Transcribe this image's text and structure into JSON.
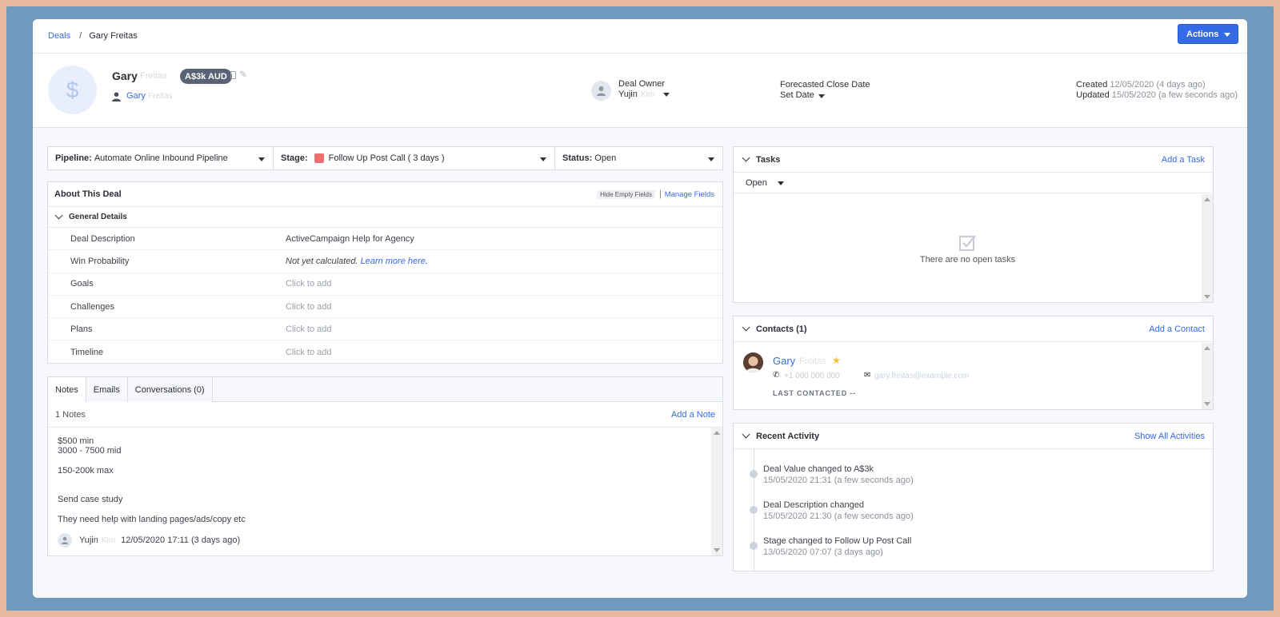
{
  "breadcrumb": {
    "parent": "Deals",
    "separator": "/",
    "current": "Gary Freitas"
  },
  "actions_label": "Actions",
  "header": {
    "avatar_glyph": "$",
    "deal_first_name": "Gary",
    "deal_last_name_obscured": "Freitas",
    "value_badge": "A$3k AUD",
    "contact_first_name": "Gary",
    "contact_last_name_obscured": "Freitas",
    "owner_label": "Deal Owner",
    "owner_name": "Yujin",
    "owner_name_obscured": "Kim",
    "close_label": "Forecasted Close Date",
    "close_value": "Set Date",
    "created_label": "Created",
    "created_value": "12/05/2020 (4 days ago)",
    "updated_label": "Updated",
    "updated_value": "15/05/2020 (a few seconds ago)"
  },
  "pipeline": {
    "pipeline_label": "Pipeline:",
    "pipeline_value": "Automate Online Inbound Pipeline",
    "stage_label": "Stage:",
    "stage_value": "Follow Up Post Call ( 3 days )",
    "stage_color": "#f06e72",
    "status_label": "Status:",
    "status_value": "Open"
  },
  "about": {
    "title": "About This Deal",
    "hide_empty": "Hide Empty Fields",
    "divider": "|",
    "manage_fields": "Manage Fields",
    "section": "General Details",
    "rows": [
      {
        "label": "Deal Description",
        "value": "ActiveCampaign Help for Agency"
      },
      {
        "label": "Win Probability",
        "value": "Not yet calculated.",
        "link": "Learn more here",
        "suffix": "."
      },
      {
        "label": "Goals",
        "value": "Click to add"
      },
      {
        "label": "Challenges",
        "value": "Click to add"
      },
      {
        "label": "Plans",
        "value": "Click to add"
      },
      {
        "label": "Timeline",
        "value": "Click to add"
      }
    ]
  },
  "notes": {
    "tabs": [
      "Notes",
      "Emails",
      "Conversations (0)"
    ],
    "count": "1 Notes",
    "add_label": "Add a Note",
    "body": [
      "$500 min",
      "3000 - 7500 mid",
      "150-200k max",
      "Send case study",
      "They need help with landing pages/ads/copy etc"
    ],
    "author": "Yujin",
    "author_obscured": "Kim",
    "timestamp": "12/05/2020 17:11 (3 days ago)"
  },
  "tasks": {
    "title": "Tasks",
    "add_label": "Add a Task",
    "filter": "Open",
    "empty_text": "There are no open tasks"
  },
  "contacts": {
    "title": "Contacts (1)",
    "add_label": "Add a Contact",
    "name": "Gary",
    "name_obscured": "Freitas",
    "phone_obscured": "+1 000 000 000",
    "email_obscured": "gary.freitas@example.com",
    "last_contacted": "LAST CONTACTED --"
  },
  "activity": {
    "title": "Recent Activity",
    "show_all": "Show All Activities",
    "items": [
      {
        "text": "Deal Value changed to ",
        "strong": "A$3k",
        "date": "15/05/2020 21:31 (a few seconds ago)"
      },
      {
        "text": "Deal Description changed",
        "strong": "",
        "date": "15/05/2020 21:30 (a few seconds ago)"
      },
      {
        "text": "Stage changed to ",
        "strong": "Follow Up Post Call",
        "date": "13/05/2020 07:07 (3 days ago)"
      }
    ]
  },
  "colors": {
    "accent": "#356ae6",
    "badge": "#5a6275",
    "frame": "#6f9abe",
    "outer": "#e6b89c"
  }
}
